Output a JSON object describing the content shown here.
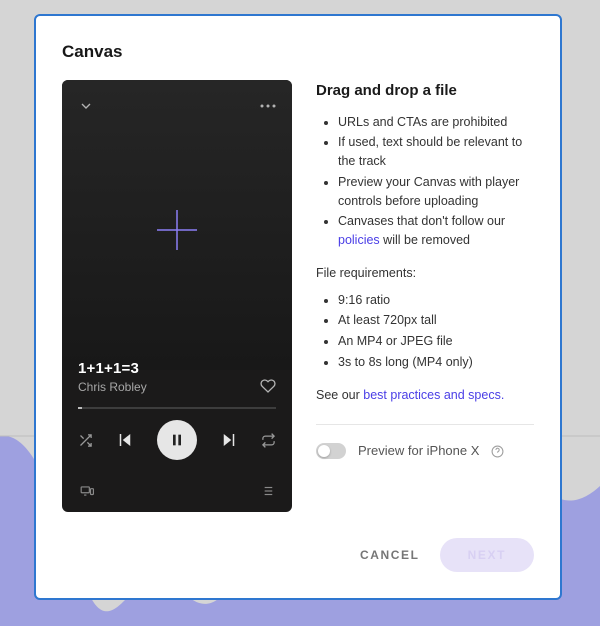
{
  "modal": {
    "title": "Canvas",
    "cancel": "CANCEL",
    "next": "NEXT"
  },
  "preview": {
    "track_title": "1+1+1=3",
    "track_artist": "Chris Robley"
  },
  "info": {
    "heading": "Drag and drop a file",
    "rules": [
      "URLs and CTAs are prohibited",
      "If used, text should be relevant to the track",
      "Preview your Canvas with player controls before uploading"
    ],
    "rule_policy_prefix": "Canvases that don't follow our ",
    "rule_policy_link": "policies",
    "rule_policy_suffix": " will be removed",
    "file_req_label": "File requirements:",
    "file_reqs": [
      "9:16 ratio",
      "At least 720px tall",
      "An MP4 or JPEG file",
      "3s to 8s long (MP4 only)"
    ],
    "see_prefix": "See our ",
    "see_link": "best practices and specs.",
    "preview_toggle_label": "Preview for iPhone X"
  }
}
